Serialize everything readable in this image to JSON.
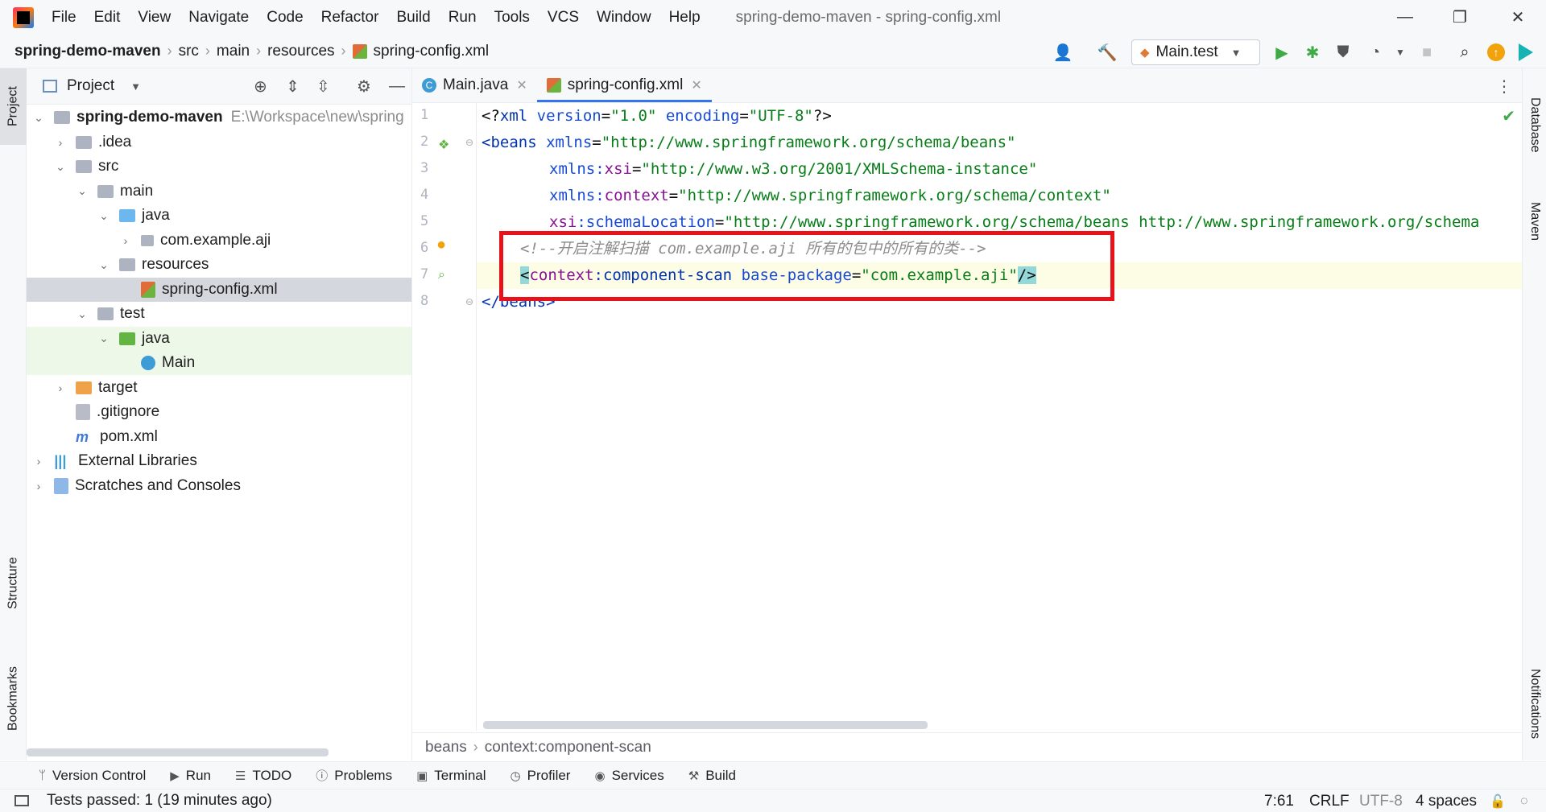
{
  "window": {
    "title": "spring-demo-maven - spring-config.xml",
    "minimize": "—",
    "maximize": "❐",
    "close": "✕"
  },
  "menu": [
    "File",
    "Edit",
    "View",
    "Navigate",
    "Code",
    "Refactor",
    "Build",
    "Run",
    "Tools",
    "VCS",
    "Window",
    "Help"
  ],
  "breadcrumb": [
    "spring-demo-maven",
    "src",
    "main",
    "resources",
    "spring-config.xml"
  ],
  "toolbar": {
    "run_config": "Main.test"
  },
  "project_panel": {
    "title": "Project",
    "tree": [
      {
        "label": "spring-demo-maven",
        "extra": "E:\\Workspace\\new\\spring",
        "level": 0,
        "expanded": true,
        "icon": "module-folder-icon",
        "bold": true
      },
      {
        "label": ".idea",
        "level": 1,
        "expanded": false,
        "icon": "folder-icon"
      },
      {
        "label": "src",
        "level": 1,
        "expanded": true,
        "icon": "folder-icon"
      },
      {
        "label": "main",
        "level": 2,
        "expanded": true,
        "icon": "folder-icon"
      },
      {
        "label": "java",
        "level": 3,
        "expanded": true,
        "icon": "source-folder-icon"
      },
      {
        "label": "com.example.aji",
        "level": 4,
        "expanded": false,
        "icon": "package-icon"
      },
      {
        "label": "resources",
        "level": 3,
        "expanded": true,
        "icon": "resources-folder-icon"
      },
      {
        "label": "spring-config.xml",
        "level": 4,
        "icon": "spring-xml-icon",
        "selected": true
      },
      {
        "label": "test",
        "level": 2,
        "expanded": true,
        "icon": "folder-icon"
      },
      {
        "label": "java",
        "level": 3,
        "expanded": true,
        "icon": "test-folder-icon"
      },
      {
        "label": "Main",
        "level": 4,
        "icon": "class-icon"
      },
      {
        "label": "target",
        "level": 1,
        "expanded": false,
        "icon": "excluded-folder-icon"
      },
      {
        "label": ".gitignore",
        "level": 1,
        "icon": "gitignore-icon"
      },
      {
        "label": "pom.xml",
        "level": 1,
        "icon": "maven-icon"
      },
      {
        "label": "External Libraries",
        "level": 0,
        "expanded": false,
        "icon": "libraries-icon"
      },
      {
        "label": "Scratches and Consoles",
        "level": 0,
        "expanded": false,
        "icon": "scratches-icon"
      }
    ]
  },
  "editor": {
    "tabs": [
      {
        "label": "Main.java",
        "active": false
      },
      {
        "label": "spring-config.xml",
        "active": true
      }
    ],
    "line_numbers": [
      "1",
      "2",
      "3",
      "4",
      "5",
      "6",
      "7",
      "8"
    ],
    "code": {
      "l1": [
        "<?",
        "xml ",
        "version",
        "=",
        "\"1.0\" ",
        "encoding",
        "=",
        "\"UTF-8\"",
        "?>"
      ],
      "l2": [
        "<beans ",
        "xmlns",
        "=",
        "\"http://www.springframework.org/schema/beans\""
      ],
      "l3": [
        "xmlns:",
        "xsi",
        "=",
        "\"http://www.w3.org/2001/XMLSchema-instance\""
      ],
      "l4": [
        "xmlns:",
        "context",
        "=",
        "\"http://www.springframework.org/schema/context\""
      ],
      "l5": [
        "xsi",
        ":schemaLocation",
        "=",
        "\"http://www.springframework.org/schema/beans http://www.springframework.org/schema"
      ],
      "l6": "<!--开启注解扫描 com.example.aji 所有的包中的所有的类-->",
      "l7": [
        "<",
        "context",
        ":component-scan ",
        "base-package",
        "=",
        "\"com.example.aji\"",
        "/>"
      ],
      "l8": [
        "</",
        "beans",
        ">"
      ]
    },
    "breadcrumbs": [
      "beans",
      "context:component-scan"
    ]
  },
  "right_tools": [
    "Database",
    "Maven",
    "Notifications"
  ],
  "left_tools": [
    "Project",
    "Structure",
    "Bookmarks"
  ],
  "bottom_tools": [
    {
      "label": "Version Control",
      "icon": "vcs-icon"
    },
    {
      "label": "Run",
      "icon": "run-icon"
    },
    {
      "label": "TODO",
      "icon": "todo-icon"
    },
    {
      "label": "Problems",
      "icon": "problems-icon"
    },
    {
      "label": "Terminal",
      "icon": "terminal-icon"
    },
    {
      "label": "Profiler",
      "icon": "profiler-icon"
    },
    {
      "label": "Services",
      "icon": "services-icon"
    },
    {
      "label": "Build",
      "icon": "build-icon"
    }
  ],
  "status": {
    "message": "Tests passed: 1 (19 minutes ago)",
    "position": "7:61",
    "line_ending": "CRLF",
    "encoding": "UTF-8",
    "indent": "4 spaces"
  },
  "colors": {
    "accent": "#3574f0",
    "highlight_box": "#e8131a",
    "run_green": "#3fab47"
  }
}
